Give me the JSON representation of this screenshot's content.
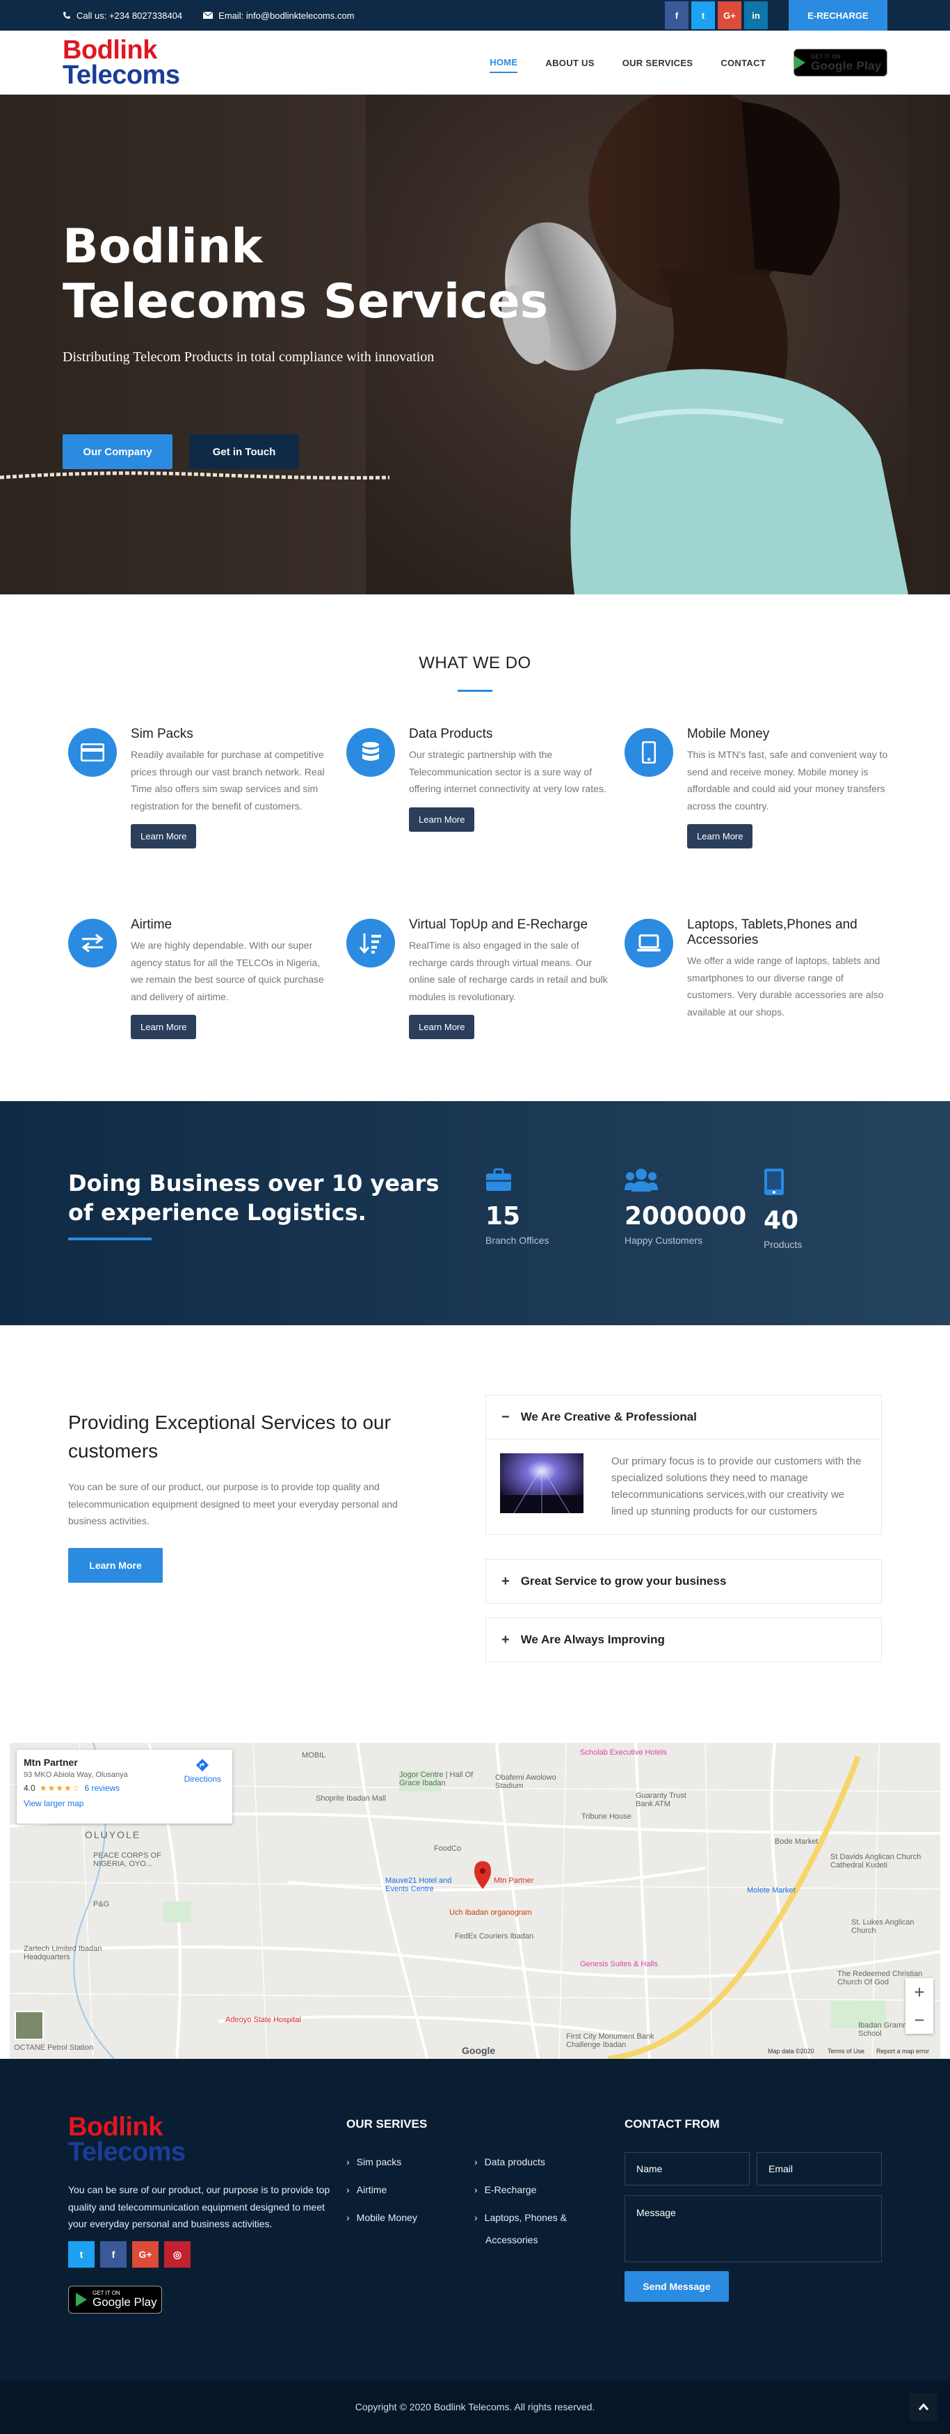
{
  "topbar": {
    "phone": "Call us: +234 8027338404",
    "email": "Email: info@bodlinktelecoms.com",
    "social": [
      {
        "label": "f",
        "icon": "facebook-icon",
        "color": "#3b5998"
      },
      {
        "label": "t",
        "icon": "twitter-icon",
        "color": "#1da1f2"
      },
      {
        "label": "G+",
        "icon": "google-plus-icon",
        "color": "#dd4b39"
      },
      {
        "label": "in",
        "icon": "linkedin-icon",
        "color": "#0e76a8"
      }
    ],
    "erecharge": "E-RECHARGE"
  },
  "logo": {
    "line1": "Bodlink",
    "line2": "Telecoms"
  },
  "nav": {
    "items": [
      "HOME",
      "ABOUT US",
      "OUR SERVICES",
      "CONTACT"
    ],
    "active": "HOME"
  },
  "googleplay": {
    "small": "GET IT ON",
    "big": "Google Play"
  },
  "hero": {
    "title_line1": "Bodlink",
    "title_line2": "Telecoms Services",
    "subtitle": "Distributing Telecom Products in total compliance with innovation",
    "btn_company": "Our Company",
    "btn_touch": "Get in Touch"
  },
  "whatwedo": {
    "title": "WHAT WE DO",
    "services": [
      {
        "title": "Sim Packs",
        "icon": "credit-card-icon",
        "text": "Readily available for purchase at competitive prices through our vast branch network. Real Time also offers sim swap services and sim registration for the benefit of customers.",
        "button": "Learn More"
      },
      {
        "title": "Data Products",
        "icon": "database-icon",
        "text": "Our strategic partnership with the Telecommunication sector is a sure way of offering internet connectivity at very low rates.",
        "button": "Learn More"
      },
      {
        "title": "Mobile Money",
        "icon": "mobile-phone-icon",
        "text": "This is MTN's fast, safe and convenient way to send and receive money. Mobile money is affordable and could aid your money transfers across the country.",
        "button": "Learn More"
      },
      {
        "title": "Airtime",
        "icon": "exchange-arrows-icon",
        "text": "We are highly dependable. With our super agency status for all the TELCOs in Nigeria, we remain the best source of quick purchase and delivery of airtime.",
        "button": "Learn More"
      },
      {
        "title": "Virtual TopUp and E-Recharge",
        "icon": "sort-amount-icon",
        "text": "RealTime is also engaged in the sale of recharge cards through virtual means. Our online sale of recharge cards in retail and bulk modules is revolutionary.",
        "button": "Learn More"
      },
      {
        "title": "Laptops, Tablets,Phones and Accessories",
        "icon": "laptop-icon",
        "text": "We offer a wide range of laptops, tablets and smartphones to our diverse range of customers. Very durable accessories are also available at our shops.",
        "button": "Learn More"
      }
    ]
  },
  "stats": {
    "heading": "Doing Business over 10 years of experience Logistics.",
    "items": [
      {
        "value": "15",
        "label": "Branch Offices",
        "icon": "briefcase-icon"
      },
      {
        "value": "2000000",
        "label": "Happy Customers",
        "icon": "users-icon"
      },
      {
        "value": "40",
        "label": "Products",
        "icon": "tablet-icon"
      }
    ]
  },
  "providing": {
    "heading": "Providing Exceptional Services to our customers",
    "text": "You can be sure of our product, our purpose is to provide top quality and telecommunication equipment designed to meet your everyday personal and business activities.",
    "button": "Learn More",
    "accordion": [
      {
        "title": "We Are Creative & Professional",
        "sign": "−",
        "open": true,
        "content": "Our primary focus is to provide our customers with the specialized solutions they need to manage telecommunications services,with our creativity we lined up stunning products for our customers"
      },
      {
        "title": "Great Service to grow your business",
        "sign": "+",
        "open": false
      },
      {
        "title": "We Are Always Improving",
        "sign": "+",
        "open": false
      }
    ]
  },
  "map": {
    "place": "Mtn Partner",
    "address": "93 MKO Abiola Way, Olusanya",
    "rating": "4.0",
    "stars": "★★★★☆",
    "reviews": "6 reviews",
    "larger": "View larger map",
    "directions": "Directions",
    "labels": [
      "MOBIL",
      "Jogor Centre | Hall Of Grace Ibadan",
      "Obafemi Awolowo Stadium",
      "Tribune House",
      "Guaranty Trust Bank ATM",
      "OLUYOLE",
      "PEACE CORPS OF NIGERIA, OYO...",
      "Mauve21 Hotel and Events Centre",
      "Mtn Partner",
      "Uch Ibadan organogram",
      "FedEx Couriers Ibadan",
      "Zartech Limited Ibadan Headquarters",
      "Adeoyo State Hospital",
      "Bode Market",
      "Molete Market",
      "St Davids Anglican Church Cathedral Kudeti",
      "St. Lukes Anglican Church",
      "The Redeemed Christian Church Of God",
      "Ibadan Grammar School",
      "First City Monument Bank Challenge Ibadan",
      "Genesis Suites & Halls",
      "Scholab Executive Hotels",
      "FoodCo",
      "Shoprite Ibadan Mall",
      "P&G",
      "OCTANE Petrol Station"
    ],
    "attribution": "Map data ©2020",
    "terms": "Terms of Use",
    "report": "Report a map error",
    "google": "Google"
  },
  "footer": {
    "about": "You can be sure of our product, our purpose is to provide top quality and telecommunication equipment designed to meet your everyday personal and business activities.",
    "social": [
      {
        "label": "t",
        "icon": "twitter-icon",
        "color": "#1da1f2"
      },
      {
        "label": "f",
        "icon": "facebook-icon",
        "color": "#3b5998"
      },
      {
        "label": "G+",
        "icon": "google-plus-icon",
        "color": "#dd4b39"
      },
      {
        "label": "◎",
        "icon": "instagram-icon",
        "color": "#c0222e"
      }
    ],
    "services_title": "OUR SERIVES",
    "services_col1": [
      "Sim packs",
      "Airtime",
      "Mobile Money"
    ],
    "services_col2": [
      "Data products",
      "E-Recharge",
      "Laptops, Phones &",
      "Accessories"
    ],
    "contact_title": "CONTACT FROM",
    "name_ph": "Name",
    "email_ph": "Email",
    "message_ph": "Message",
    "send": "Send Message",
    "copyright": "Copyright © 2020 Bodlink Telecoms. All rights reserved."
  },
  "colors": {
    "accent": "#2b8be0",
    "navy": "#0e2a47",
    "logo_red": "#e2161e",
    "logo_blue": "#1b3d97"
  }
}
